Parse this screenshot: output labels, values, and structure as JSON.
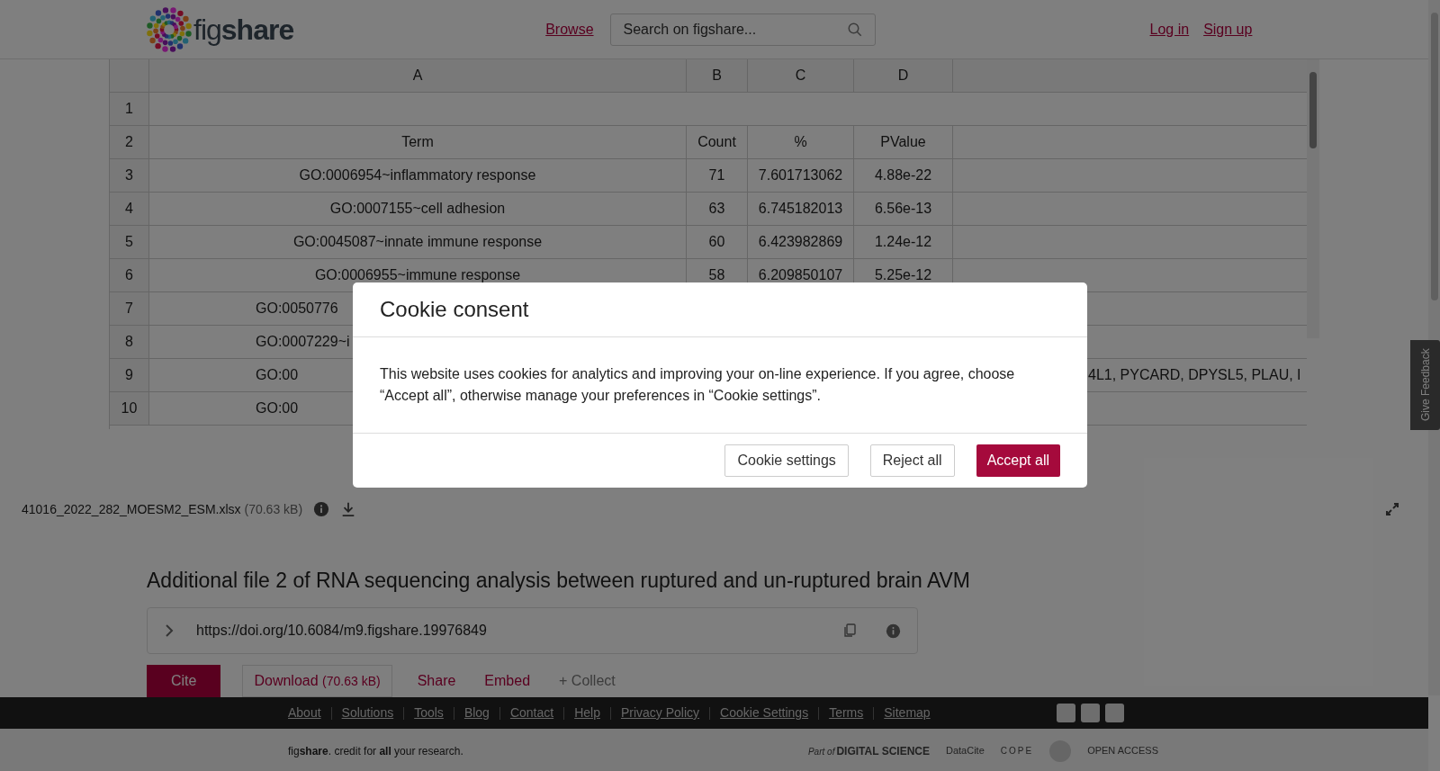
{
  "header": {
    "logo": {
      "light": "fig",
      "bold": "share"
    },
    "nav": [
      "Browse"
    ],
    "search": {
      "placeholder": "Search on figshare..."
    },
    "auth": [
      "Log in",
      "Sign up"
    ]
  },
  "sheet": {
    "columns": [
      "A",
      "B",
      "C",
      "D"
    ],
    "rows": [
      {
        "number": "1",
        "kind": "full",
        "cells": []
      },
      {
        "number": "2",
        "kind": "full",
        "cells": [
          "Term",
          "Count",
          "%",
          "PValue"
        ]
      },
      {
        "number": "3",
        "kind": "full",
        "cells": [
          "GO:0006954~inflammatory response",
          "71",
          "7.601713062",
          "4.88e-22"
        ]
      },
      {
        "number": "4",
        "kind": "full",
        "cells": [
          "GO:0007155~cell adhesion",
          "63",
          "6.745182013",
          "6.56e-13"
        ]
      },
      {
        "number": "5",
        "kind": "full",
        "cells": [
          "GO:0045087~innate immune response",
          "60",
          "6.423982869",
          "1.24e-12"
        ]
      },
      {
        "number": "6",
        "kind": "full",
        "cells": [
          "GO:0006955~immune response",
          "58",
          "6.209850107",
          "5.25e-12"
        ]
      },
      {
        "number": "7",
        "kind": "partial",
        "cells": [
          "GO:0050776"
        ]
      },
      {
        "number": "8",
        "kind": "partial",
        "cells": [
          "GO:0007229~i"
        ]
      },
      {
        "number": "9",
        "kind": "partial",
        "cells": [
          "GO:00"
        ],
        "overflow": "4L1, PYCARD, DPYSL5, PLAU, I"
      },
      {
        "number": "10",
        "kind": "partial",
        "cells": [
          "GO:00"
        ]
      }
    ]
  },
  "file": {
    "name": "41016_2022_282_MOESM2_ESM.xlsx",
    "size": "(70.63 kB)"
  },
  "item": {
    "title": "Additional file 2 of RNA sequencing analysis between ruptured and un-ruptured brain AVM",
    "doi": "https://doi.org/10.6084/m9.figshare.19976849",
    "actions": [
      {
        "kind": "primary",
        "label": "Cite"
      },
      {
        "kind": "outline",
        "label": "Download",
        "detail": "(70.63 kB)"
      },
      {
        "kind": "link",
        "label": "Share"
      },
      {
        "kind": "link",
        "label": "Embed"
      },
      {
        "kind": "muted",
        "label": "+ Collect"
      }
    ]
  },
  "footer": {
    "links": [
      "About",
      "Solutions",
      "Tools",
      "Blog",
      "Contact",
      "Help",
      "Privacy Policy",
      "Cookie Settings",
      "Terms",
      "Sitemap"
    ],
    "tagline": "fig**share**. credit for **all** your research.",
    "partners": [
      "Part of",
      "DIGITAL SCIENCE",
      "DataCite",
      "COPE",
      "OPEN ACCESS"
    ]
  },
  "feedback": "Give Feedback",
  "cookie_modal": {
    "title": "Cookie consent",
    "body": "This website uses cookies for analytics and improving your on-line experience. If you agree, choose “Accept all”, otherwise manage your preferences in “Cookie settings”.",
    "buttons": [
      {
        "kind": "outline",
        "label": "Cookie settings"
      },
      {
        "kind": "outline",
        "label": "Reject all"
      },
      {
        "kind": "primary",
        "label": "Accept all"
      }
    ]
  }
}
